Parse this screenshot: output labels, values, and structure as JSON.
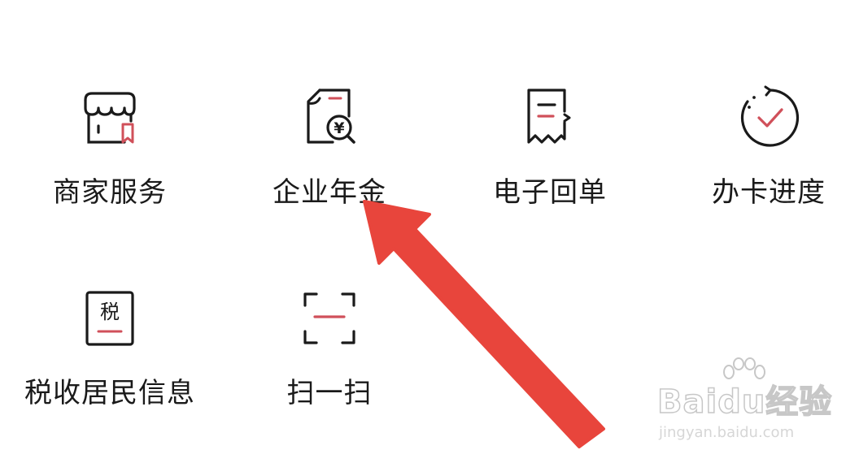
{
  "services": [
    {
      "id": "merchant",
      "label": "商家服务",
      "icon": "storefront-icon"
    },
    {
      "id": "annuity",
      "label": "企业年金",
      "icon": "document-yuan-search-icon"
    },
    {
      "id": "ereceipt",
      "label": "电子回单",
      "icon": "receipt-icon"
    },
    {
      "id": "card_progress",
      "label": "办卡进度",
      "icon": "refresh-check-icon"
    },
    {
      "id": "tax_residency",
      "label": "税收居民信息",
      "icon": "tax-badge-icon",
      "icon_text": "税"
    },
    {
      "id": "scan",
      "label": "扫一扫",
      "icon": "scan-frame-icon"
    }
  ],
  "watermark": {
    "brand": "Baidu经验",
    "url": "jingyan.baidu.com"
  },
  "colors": {
    "icon_stroke": "#1a1a1a",
    "icon_accent": "#d0505a",
    "label": "#1a1a1a",
    "annotation_arrow": "#e8453c"
  }
}
